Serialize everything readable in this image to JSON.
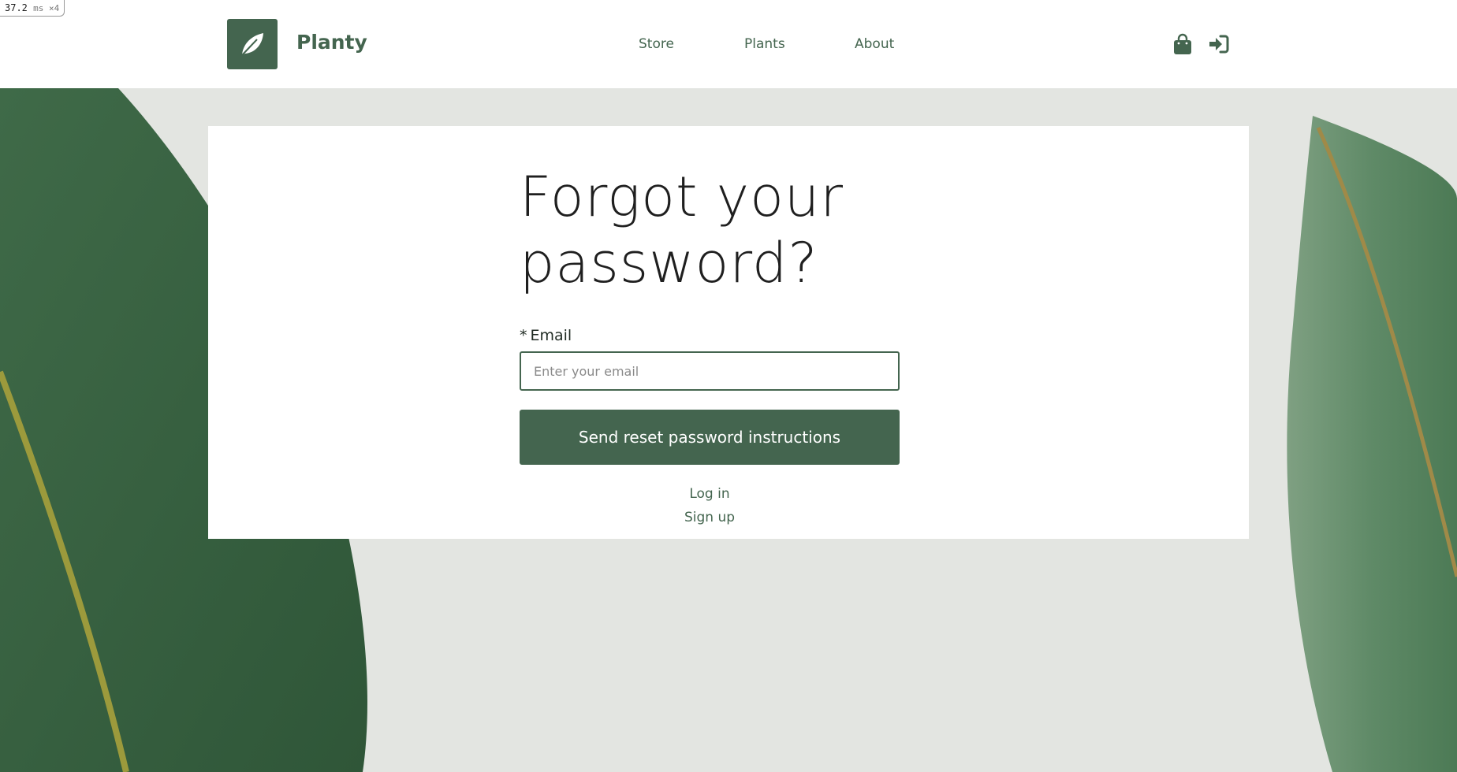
{
  "perf_badge": {
    "value": "37.2",
    "unit": "ms ×4"
  },
  "brand": {
    "name": "Planty",
    "logo_icon": "leaf-icon"
  },
  "nav": {
    "items": [
      {
        "label": "Store"
      },
      {
        "label": "Plants"
      },
      {
        "label": "About"
      }
    ]
  },
  "header_icons": {
    "cart_icon": "shopping-bag-icon",
    "login_icon": "sign-in-icon"
  },
  "form": {
    "title": "Forgot your password?",
    "required_marker": "*",
    "email_label": "Email",
    "email_placeholder": "Enter your email",
    "email_value": "",
    "submit_label": "Send reset password instructions",
    "login_link": "Log in",
    "signup_link": "Sign up"
  },
  "colors": {
    "brand": "#44654f",
    "background": "#e3e5e1",
    "card": "#ffffff",
    "title_text": "#1f1f1f"
  }
}
